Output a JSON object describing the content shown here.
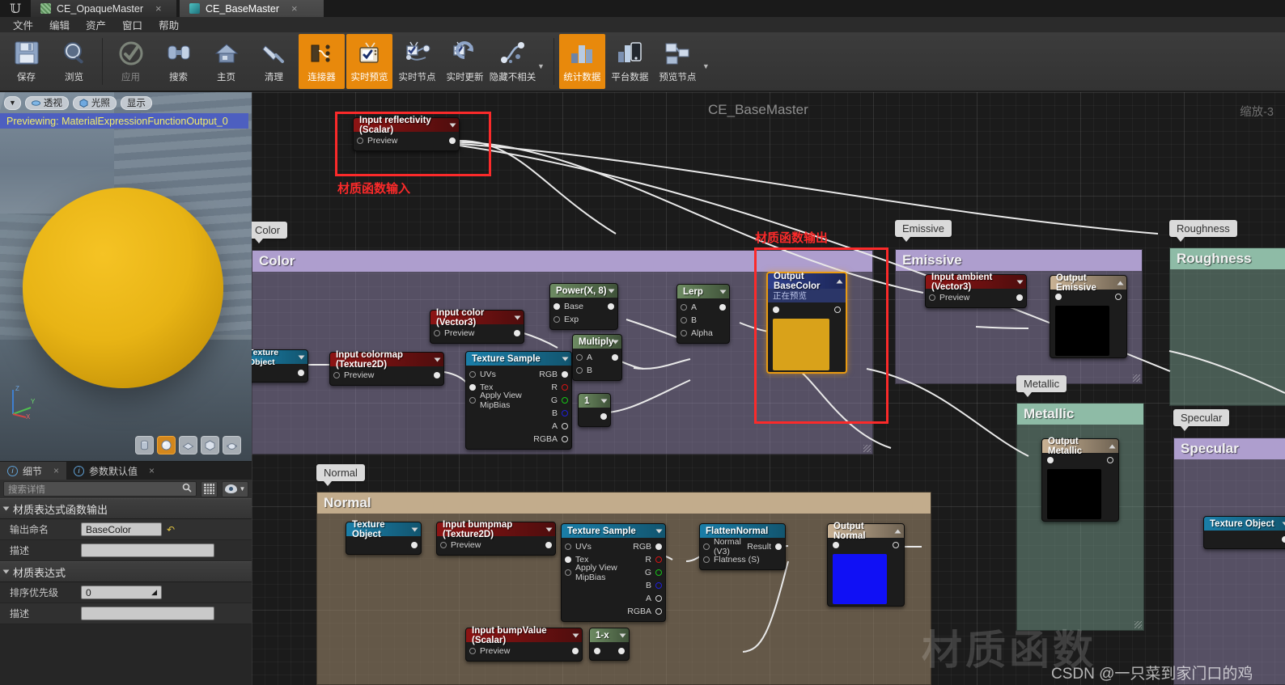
{
  "window": {
    "tabs": [
      {
        "label": "CE_OpaqueMaster",
        "active": false
      },
      {
        "label": "CE_BaseMaster",
        "active": true
      }
    ],
    "close_glyph": "×"
  },
  "menu": {
    "items": [
      "文件",
      "编辑",
      "资产",
      "窗口",
      "帮助"
    ]
  },
  "toolbar": {
    "buttons": [
      {
        "label": "保存",
        "icon": "save-icon",
        "state": "normal"
      },
      {
        "label": "浏览",
        "icon": "browse-magnifier-icon",
        "state": "normal"
      },
      {
        "label": "应用",
        "icon": "apply-check-icon",
        "state": "disabled"
      },
      {
        "label": "搜索",
        "icon": "search-binoculars-icon",
        "state": "normal"
      },
      {
        "label": "主页",
        "icon": "home-icon",
        "state": "normal"
      },
      {
        "label": "清理",
        "icon": "clean-brush-icon",
        "state": "normal"
      },
      {
        "label": "连接器",
        "icon": "connectors-icon",
        "state": "active"
      },
      {
        "label": "实时预览",
        "icon": "live-preview-icon",
        "state": "active"
      },
      {
        "label": "实时节点",
        "icon": "live-nodes-icon",
        "state": "normal"
      },
      {
        "label": "实时更新",
        "icon": "live-update-icon",
        "state": "normal"
      },
      {
        "label": "隐藏不相关",
        "icon": "hide-unrelated-icon",
        "state": "normal"
      },
      {
        "label": "统计数据",
        "icon": "stats-icon",
        "state": "active"
      },
      {
        "label": "平台数据",
        "icon": "platform-stats-icon",
        "state": "normal"
      },
      {
        "label": "预览节点",
        "icon": "preview-node-icon",
        "state": "normal"
      }
    ]
  },
  "viewport": {
    "chips": [
      {
        "label": "透视",
        "icon": "perspective-icon"
      },
      {
        "label": "光照",
        "icon": "lit-cube-icon"
      },
      {
        "label": "显示",
        "icon": "show-icon"
      }
    ],
    "previewing": "Previewing: MaterialExpressionFunctionOutput_0",
    "shapes": [
      {
        "name": "cylinder-preview",
        "selected": false
      },
      {
        "name": "sphere-preview",
        "selected": true
      },
      {
        "name": "plane-preview",
        "selected": false
      },
      {
        "name": "cube-preview",
        "selected": false
      },
      {
        "name": "teapot-preview",
        "selected": false
      }
    ],
    "axis": {
      "x": "X",
      "y": "Y",
      "z": "Z"
    }
  },
  "details": {
    "tabs": [
      {
        "label": "细节",
        "active": true
      },
      {
        "label": "参数默认值",
        "active": false
      }
    ],
    "search_placeholder": "搜索详情",
    "sections": [
      {
        "title": "材质表达式函数输出",
        "rows": [
          {
            "label": "输出命名",
            "value": "BaseColor",
            "has_reset": true
          },
          {
            "label": "描述",
            "value": "",
            "has_reset": false
          }
        ]
      },
      {
        "title": "材质表达式",
        "rows": [
          {
            "label": "排序优先级",
            "value": "0",
            "has_reset": false
          },
          {
            "label": "描述",
            "value": "",
            "has_reset": false
          }
        ]
      }
    ]
  },
  "graph": {
    "title": "CE_BaseMaster",
    "zoom_label": "缩放-3",
    "annotations": [
      {
        "text": "材质函数输入",
        "color": "#fb2a2a"
      },
      {
        "text": "材质函数输出",
        "color": "#fb2a2a"
      }
    ],
    "comments": [
      {
        "name": "Color",
        "bubble": "Color",
        "color": "#a99bc9",
        "bar": "#ae9ece"
      },
      {
        "name": "Emissive",
        "bubble": "Emissive",
        "color": "#a99bc9",
        "bar": "#ae9ece"
      },
      {
        "name": "Roughness",
        "bubble": "Roughness",
        "color": "#7aa191",
        "bar": "#8ebba6"
      },
      {
        "name": "Metallic",
        "bubble": "Metallic",
        "color": "#7aa191",
        "bar": "#8ebba6"
      },
      {
        "name": "Specular",
        "bubble": "Specular",
        "color": "#a99bc9",
        "bar": "#ae9ece"
      },
      {
        "name": "Normal",
        "bubble": "Normal",
        "color": "#a08a6e",
        "bar": "#c2ac8c"
      }
    ],
    "nodes": [
      {
        "title": "Input reflectivity (Scalar)",
        "kind": "input",
        "pins_in": [
          "Preview"
        ]
      },
      {
        "title": "Texture Object",
        "kind": "texture",
        "pins_in": []
      },
      {
        "title": "Input colormap (Texture2D)",
        "kind": "input",
        "pins_in": [
          "Preview"
        ]
      },
      {
        "title": "Input color (Vector3)",
        "kind": "input",
        "pins_in": [
          "Preview"
        ]
      },
      {
        "title": "Texture Sample",
        "kind": "texture",
        "pins_in": [
          "UVs",
          "Tex",
          "Apply View MipBias"
        ],
        "pins_out": [
          "RGB",
          "R",
          "G",
          "B",
          "A",
          "RGBA"
        ]
      },
      {
        "title": "Power(X, 8)",
        "kind": "math",
        "pins_in": [
          "Base",
          "Exp"
        ]
      },
      {
        "title": "Multiply",
        "kind": "math",
        "pins_in": [
          "A",
          "B"
        ]
      },
      {
        "title": "1",
        "kind": "math",
        "pins_in": []
      },
      {
        "title": "Lerp",
        "kind": "math",
        "pins_in": [
          "A",
          "B",
          "Alpha"
        ]
      },
      {
        "title": "Output BaseColor",
        "kind": "output-sel",
        "subtitle": "正在预览",
        "swatch": "#d9a21a"
      },
      {
        "title": "Input ambient (Vector3)",
        "kind": "input",
        "pins_in": [
          "Preview"
        ]
      },
      {
        "title": "Output Emissive",
        "kind": "output",
        "swatch": "#000000"
      },
      {
        "title": "Output Metallic",
        "kind": "output",
        "swatch": "#000000"
      },
      {
        "title": "Texture Object",
        "kind": "texture",
        "pins_in": []
      },
      {
        "title": "Texture Object",
        "kind": "texture",
        "pins_in": []
      },
      {
        "title": "Input bumpmap (Texture2D)",
        "kind": "input",
        "pins_in": [
          "Preview"
        ]
      },
      {
        "title": "Texture Sample",
        "kind": "texture",
        "pins_in": [
          "UVs",
          "Tex",
          "Apply View MipBias"
        ],
        "pins_out": [
          "RGB",
          "R",
          "G",
          "B",
          "A",
          "RGBA"
        ]
      },
      {
        "title": "FlattenNormal",
        "kind": "texture",
        "pins_in": [
          "Normal (V3)",
          "Flatness (S)"
        ],
        "pins_out": [
          "Result"
        ]
      },
      {
        "title": "Output Normal",
        "kind": "output",
        "swatch": "#1010f5"
      },
      {
        "title": "Input bumpValue (Scalar)",
        "kind": "input",
        "pins_in": [
          "Preview"
        ]
      },
      {
        "title": "1-x",
        "kind": "math",
        "pins_in": []
      }
    ]
  },
  "watermark": {
    "big": "材质函数",
    "small": "CSDN @一只菜到家门口的鸡"
  },
  "colors": {
    "accent": "#e8890c",
    "node_red": "#8d1414",
    "node_green": "#6d8b62",
    "node_blue": "#1a7ea8",
    "node_tan": "#c9b294",
    "annotation_red": "#fb2a2a",
    "basecolor_swatch": "#d9a21a",
    "normal_swatch": "#1010f5"
  }
}
